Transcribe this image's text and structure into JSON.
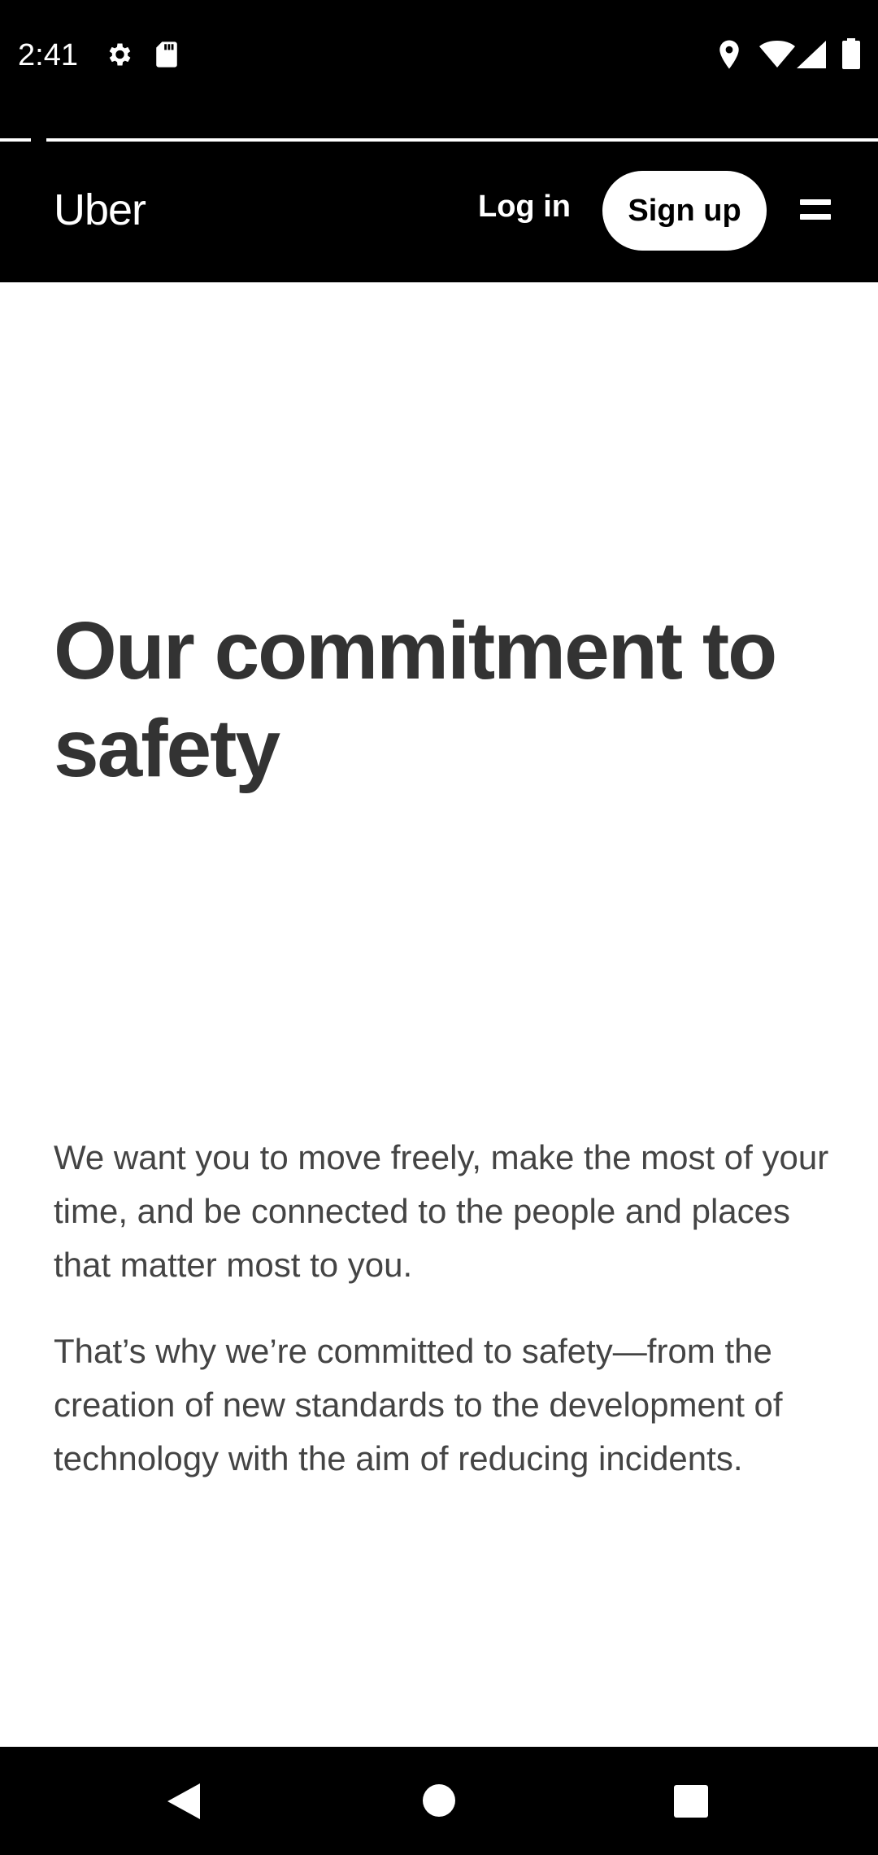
{
  "status_bar": {
    "time": "2:41",
    "icons": [
      "settings-icon",
      "sd-card-icon",
      "location-icon",
      "wifi-icon",
      "signal-icon",
      "battery-icon"
    ]
  },
  "header": {
    "logo": "Uber",
    "login_label": "Log in",
    "signup_label": "Sign up",
    "menu_icon": "hamburger-menu-icon"
  },
  "main": {
    "title": "Our commitment to safety",
    "paragraph_1": "We want you to move freely, make the most of your time, and be connected to the people and places that matter most to you.",
    "paragraph_2": "That’s why we’re committed to safety—from the creation of new standards to the development of technology with the aim of reducing incidents."
  },
  "nav_bar": {
    "icons": [
      "back-icon",
      "home-icon",
      "recents-icon"
    ]
  },
  "colors": {
    "header_bg": "#000000",
    "page_bg": "#ffffff",
    "title_text": "#333333",
    "body_text": "#444444"
  }
}
